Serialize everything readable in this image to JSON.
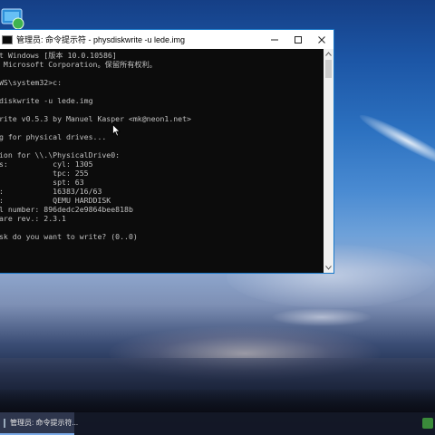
{
  "window": {
    "title": "管理员: 命令提示符 - physdiskwrite  -u lede.img",
    "buttons": {
      "minimize": "—",
      "maximize": "☐",
      "close": "✕"
    }
  },
  "console": {
    "lines": [
      "t Windows [版本 10.0.10586]",
      " Microsoft Corporation。保留所有权利。",
      "",
      "WS\\system32>c:",
      "",
      "diskwrite -u lede.img",
      "",
      "rite v0.5.3 by Manuel Kasper <mk@neon1.net>",
      "",
      "g for physical drives...",
      "",
      "ion for \\\\.\\PhysicalDrive0:",
      "s:          cyl: 1305",
      "            tpc: 255",
      "            spt: 63",
      ":           16383/16/63",
      ":           QEMU HARDDISK",
      "l number: 896dedc2e9864bee818b",
      "are rev.: 2.3.1",
      "",
      "sk do you want to write? (0..0)"
    ]
  },
  "taskbar": {
    "item_label": "管理员: 命令提示符..."
  },
  "colors": {
    "window_border": "#1979ca",
    "console_bg": "#0c0c0c",
    "console_text": "#c0c0c0"
  }
}
